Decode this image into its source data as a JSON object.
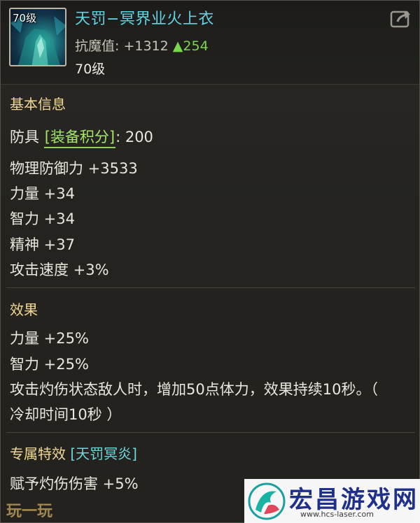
{
  "item": {
    "icon": "armor-item-icon",
    "level_badge": "70级",
    "name": "天罚−冥界业火上衣",
    "stat_label": "抗魔值: ",
    "stat_value": "+1312 ",
    "stat_gain": "▲254",
    "required_level": "70级",
    "share_icon": "share-icon"
  },
  "basic": {
    "title": "基本信息",
    "category": "防具 ",
    "score_tag": "[装备积分]",
    "score_value": ": 200",
    "lines": [
      "物理防御力 +3533",
      "力量 +34",
      "智力 +34",
      "精神 +37",
      "攻击速度 +3%"
    ]
  },
  "effects": {
    "title": "效果",
    "lines": [
      "力量 +25%",
      "智力 +25%",
      "攻击灼伤状态敌人时，增加50点体力，效果持续10秒。（",
      "冷却时间10秒 ）"
    ]
  },
  "exclusive": {
    "title": "专属特效 ",
    "tag": "[天罚冥炎]",
    "lines": [
      "赋予灼伤伤害 +5%"
    ]
  },
  "watermarks": {
    "left": "玩一玩",
    "site_name": "宏昌游戏网",
    "site_url": "www.hcs-laser.com",
    "logo": "dragon-logo-icon"
  },
  "colors": {
    "name": "#62d3e0",
    "section": "#f2d896",
    "tag_green": "#a4e66c",
    "tag_cyan": "#6fd6d9",
    "gain": "#79d64f"
  }
}
